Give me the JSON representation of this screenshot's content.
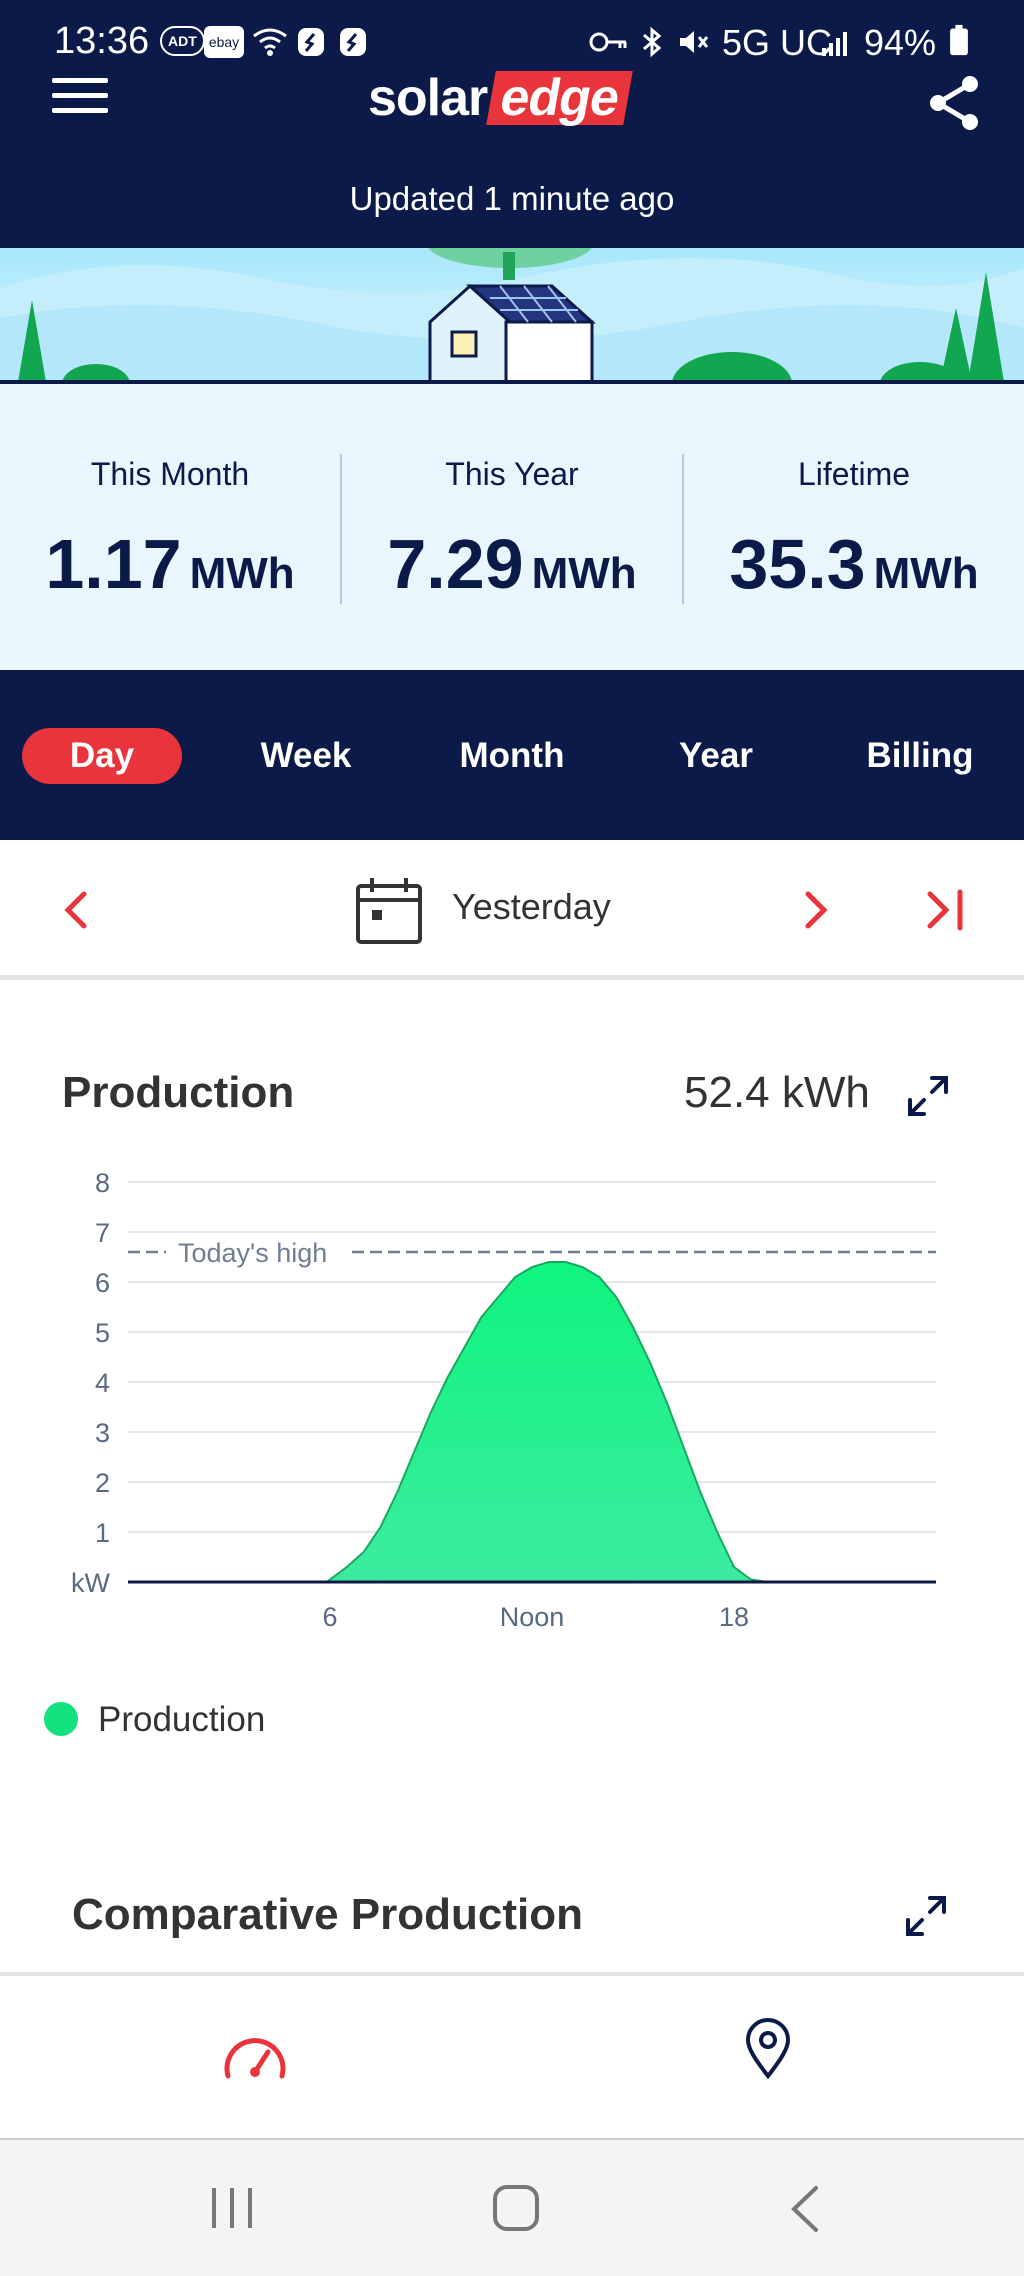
{
  "status_bar": {
    "time": "13:36",
    "adt_badge": "ADT",
    "ebay_badge": "ebay",
    "network": "5G UC",
    "battery": "94%",
    "icons": [
      "adt-icon",
      "ebay-icon",
      "wifi-calling-icon",
      "shazam-icon",
      "shazam-icon",
      "vpn-key-icon",
      "bluetooth-icon",
      "mute-icon",
      "signal-icon",
      "battery-icon"
    ]
  },
  "header": {
    "logo_solar": "solar",
    "logo_edge": "edge",
    "updated": "Updated 1 minute ago"
  },
  "stats": [
    {
      "label": "This Month",
      "value": "1.17",
      "unit": "MWh"
    },
    {
      "label": "This Year",
      "value": "7.29",
      "unit": "MWh"
    },
    {
      "label": "Lifetime",
      "value": "35.3",
      "unit": "MWh"
    }
  ],
  "range_tabs": {
    "items": [
      "Day",
      "Week",
      "Month",
      "Year",
      "Billing"
    ],
    "active": "Day"
  },
  "date_nav": {
    "label": "Yesterday"
  },
  "production": {
    "title": "Production",
    "total": "52.4 kWh",
    "legend": "Production",
    "color": "#12e27e"
  },
  "chart_data": {
    "type": "area",
    "y_unit_label": "kW",
    "y_ticks": [
      "1",
      "2",
      "3",
      "4",
      "5",
      "6",
      "7",
      "8"
    ],
    "ylim": [
      0,
      8
    ],
    "x_ticks": [
      {
        "x": 6,
        "label": "6"
      },
      {
        "x": 12,
        "label": "Noon"
      },
      {
        "x": 18,
        "label": "18"
      }
    ],
    "xlim": [
      0,
      24
    ],
    "reference_line": {
      "label": "Today's high",
      "value": 6.6
    },
    "grid": true,
    "series": [
      {
        "name": "Production",
        "x": [
          0,
          5.9,
          6.5,
          7,
          7.5,
          8,
          8.5,
          9,
          9.5,
          10,
          10.5,
          11,
          11.5,
          12,
          12.5,
          13,
          13.5,
          14,
          14.5,
          15,
          15.5,
          16,
          16.5,
          17,
          17.5,
          18,
          18.5,
          19,
          19.5,
          20,
          24
        ],
        "y": [
          0,
          0,
          0.3,
          0.6,
          1.1,
          1.8,
          2.6,
          3.4,
          4.1,
          4.7,
          5.3,
          5.7,
          6.1,
          6.3,
          6.4,
          6.4,
          6.3,
          6.1,
          5.7,
          5.1,
          4.4,
          3.6,
          2.7,
          1.8,
          1.0,
          0.3,
          0.05,
          0,
          0,
          0,
          0
        ]
      }
    ]
  },
  "comparative": {
    "title": "Comparative Production"
  }
}
